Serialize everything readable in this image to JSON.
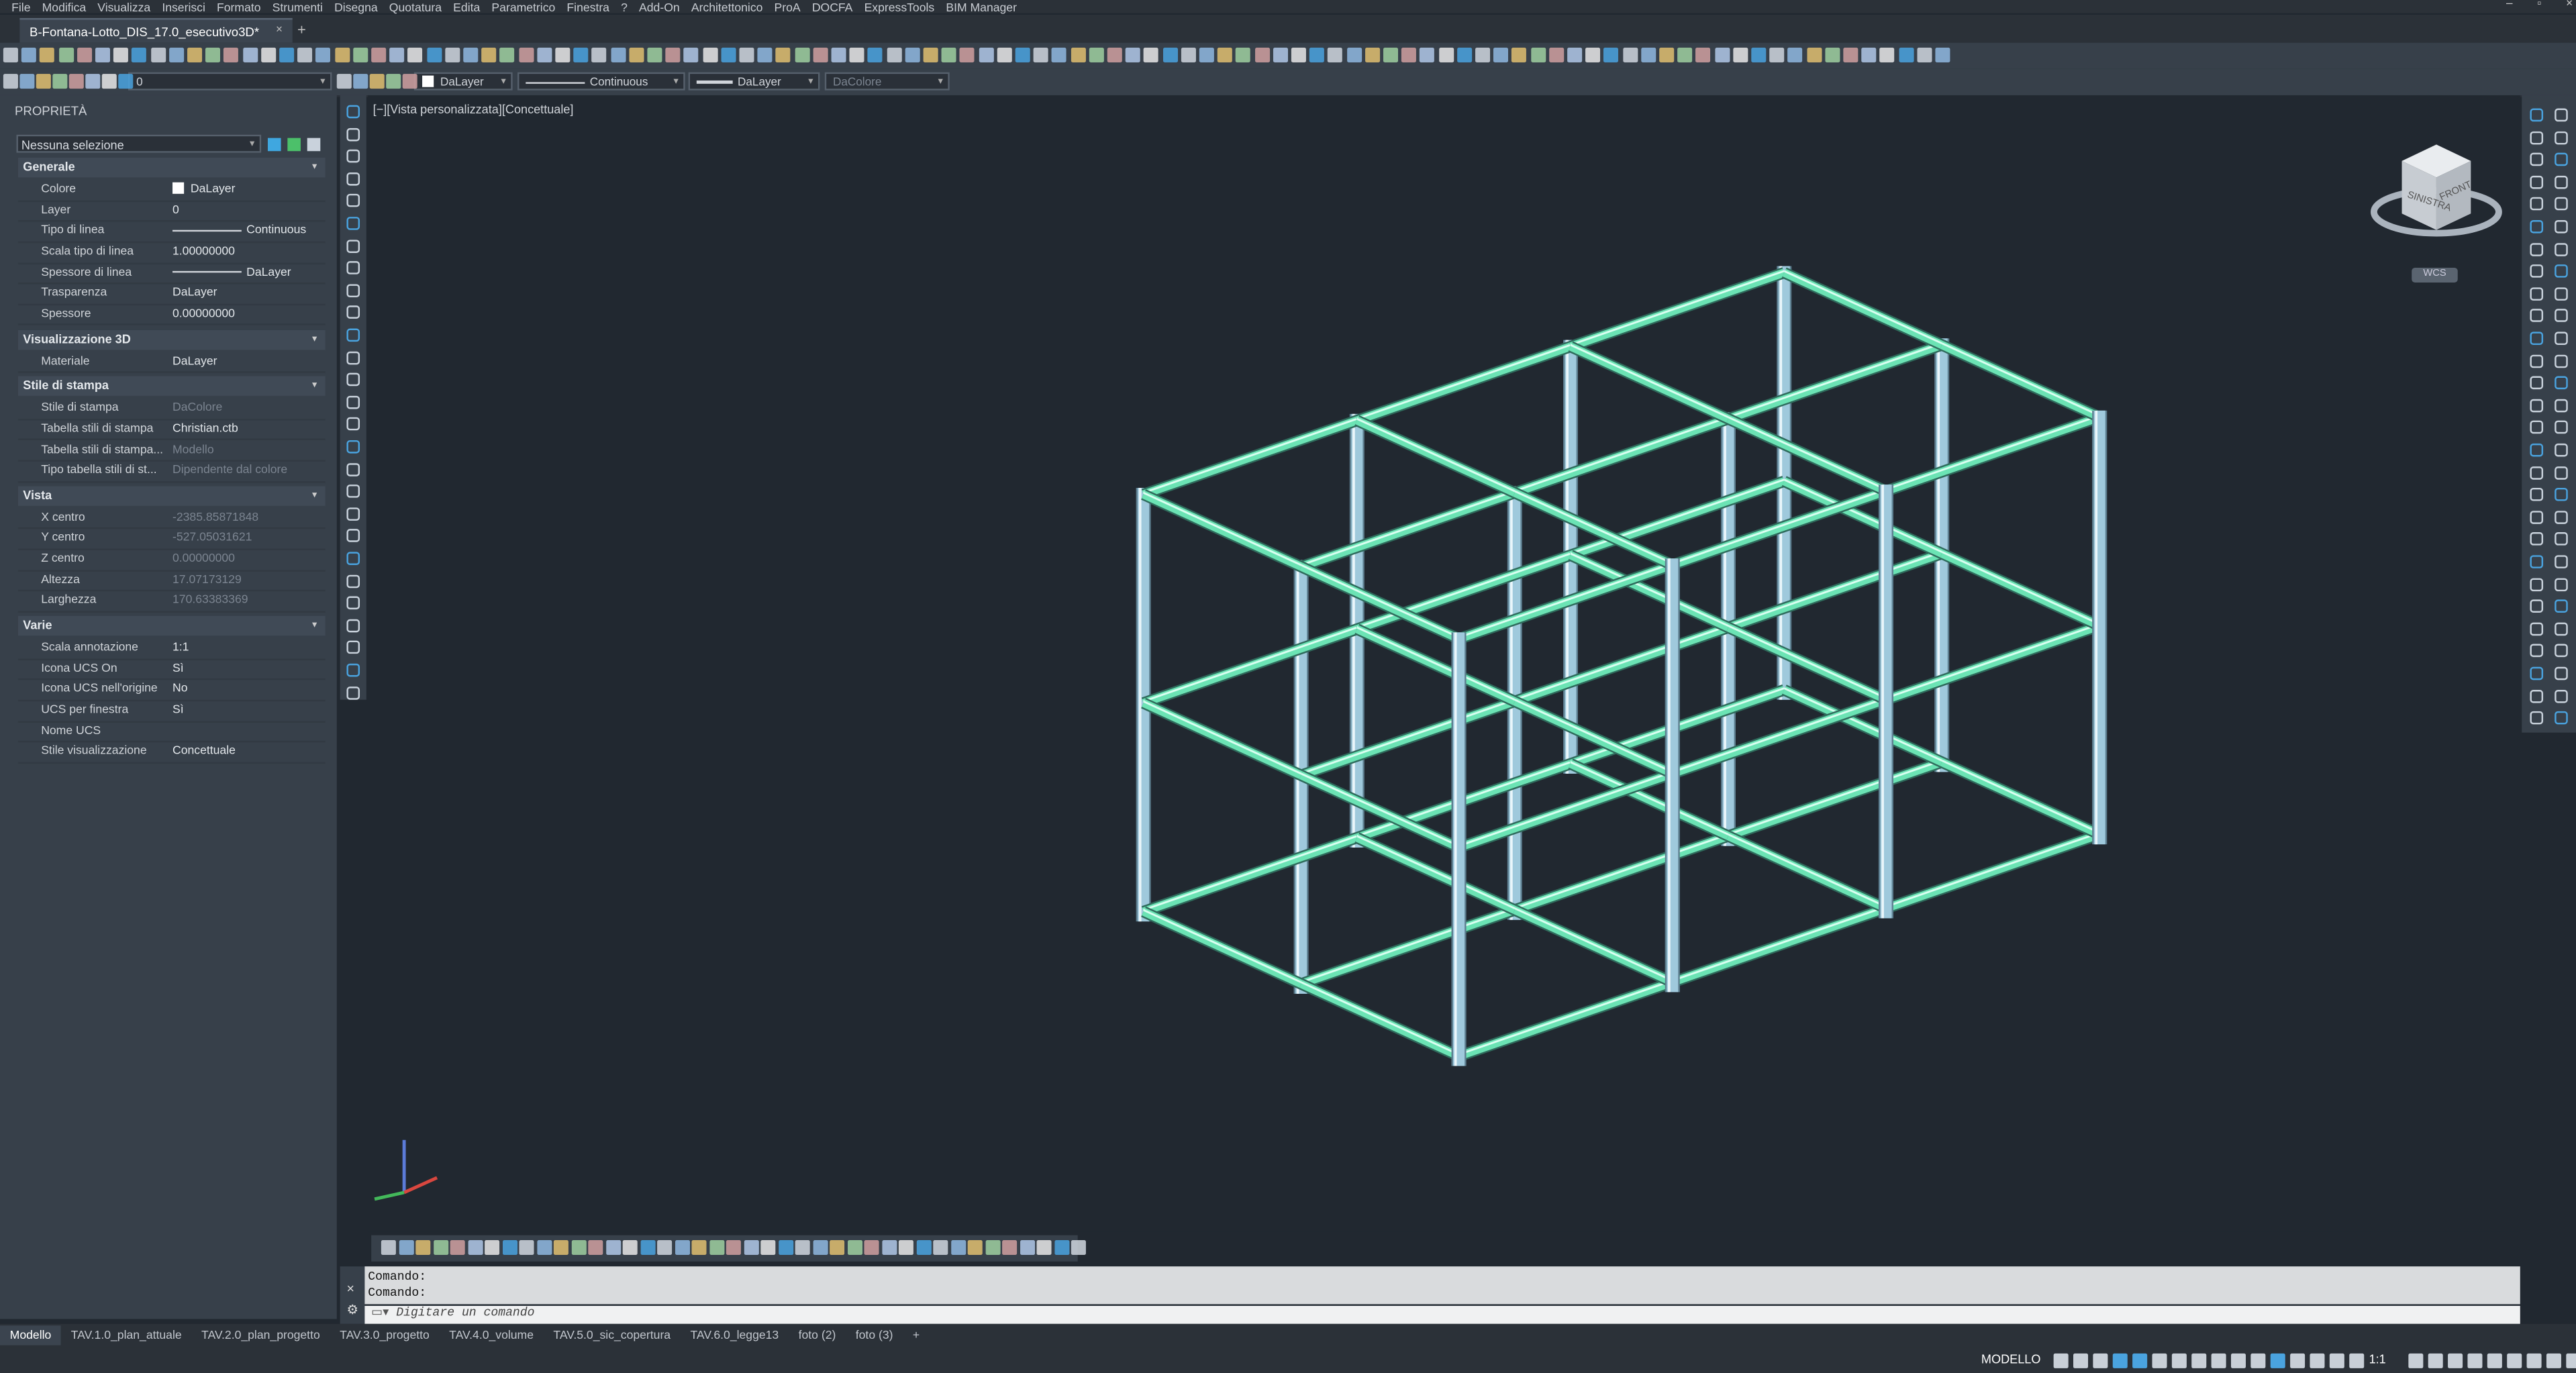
{
  "menu": [
    "File",
    "Modifica",
    "Visualizza",
    "Inserisci",
    "Formato",
    "Strumenti",
    "Disegna",
    "Quotatura",
    "Edita",
    "Parametrico",
    "Finestra",
    "?",
    "Add-On",
    "Architettonico",
    "ProA",
    "DOCFA",
    "ExpressTools",
    "BIM Manager"
  ],
  "document_tab": {
    "title": "B-Fontana-Lotto_DIS_17.0_esecutivo3D*",
    "close": "×"
  },
  "new_tab": "+",
  "layer_bar": {
    "layer_value": "0",
    "color": "DaLayer",
    "linetype": "Continuous",
    "lineweight": "DaLayer",
    "plotstyle": "DaColore"
  },
  "properties": {
    "title": "PROPRIETÀ",
    "selection": "Nessuna selezione",
    "sections": {
      "generale": {
        "title": "Generale",
        "rows": [
          {
            "k": "Colore",
            "v": "DaLayer"
          },
          {
            "k": "Layer",
            "v": "0"
          },
          {
            "k": "Tipo di linea",
            "v": "Continuous"
          },
          {
            "k": "Scala tipo di linea",
            "v": "1.00000000"
          },
          {
            "k": "Spessore di linea",
            "v": "DaLayer"
          },
          {
            "k": "Trasparenza",
            "v": "DaLayer"
          },
          {
            "k": "Spessore",
            "v": "0.00000000"
          }
        ]
      },
      "vis3d": {
        "title": "Visualizzazione 3D",
        "rows": [
          {
            "k": "Materiale",
            "v": "DaLayer"
          }
        ]
      },
      "stampa": {
        "title": "Stile di stampa",
        "rows": [
          {
            "k": "Stile di stampa",
            "v": "DaColore"
          },
          {
            "k": "Tabella stili di stampa",
            "v": "Christian.ctb"
          },
          {
            "k": "Tabella stili di stampa...",
            "v": "Modello"
          },
          {
            "k": "Tipo tabella stili di st...",
            "v": "Dipendente dal colore"
          }
        ]
      },
      "vista": {
        "title": "Vista",
        "rows": [
          {
            "k": "X centro",
            "v": "-2385.85871848"
          },
          {
            "k": "Y centro",
            "v": "-527.05031621"
          },
          {
            "k": "Z centro",
            "v": "0.00000000"
          },
          {
            "k": "Altezza",
            "v": "17.07173129"
          },
          {
            "k": "Larghezza",
            "v": "170.63383369"
          }
        ]
      },
      "varie": {
        "title": "Varie",
        "rows": [
          {
            "k": "Scala annotazione",
            "v": "1:1"
          },
          {
            "k": "Icona UCS On",
            "v": "Sì"
          },
          {
            "k": "Icona UCS nell'origine",
            "v": "No"
          },
          {
            "k": "UCS per finestra",
            "v": "Sì"
          },
          {
            "k": "Nome UCS",
            "v": ""
          },
          {
            "k": "Stile visualizzazione",
            "v": "Concettuale"
          }
        ]
      }
    }
  },
  "viewport": {
    "label": "[−][Vista personalizzata][Concettuale]",
    "viewcube_left": "SINISTRA",
    "viewcube_front": "FRONT",
    "wcs": "WCS",
    "frame_color": "#6be3b4",
    "column_color": "#9fc9dc"
  },
  "command": {
    "history": [
      "Comando:",
      "Comando:"
    ],
    "placeholder": "Digitare un comando"
  },
  "layout_tabs": [
    "Modello",
    "TAV.1.0_plan_attuale",
    "TAV.2.0_plan_progetto",
    "TAV.3.0_progetto",
    "TAV.4.0_volume",
    "TAV.5.0_sic_copertura",
    "TAV.6.0_legge13",
    "foto (2)",
    "foto (3)",
    "+"
  ],
  "status": {
    "space": "MODELLO",
    "scale": "1:1"
  }
}
